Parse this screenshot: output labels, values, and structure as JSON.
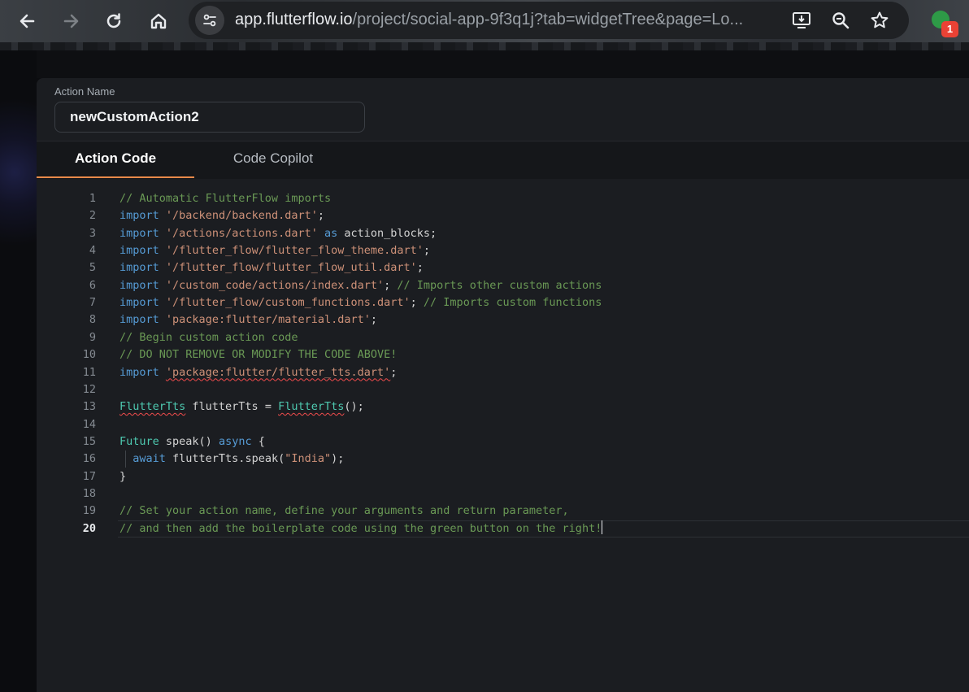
{
  "browser": {
    "url_host": "app.flutterflow.io",
    "url_path": "/project/social-app-9f3q1j?tab=widgetTree&page=Lo...",
    "extension_badge": "1",
    "icons": [
      "back-arrow-icon",
      "forward-arrow-icon",
      "reload-icon",
      "home-icon",
      "site-info-icon",
      "install-app-icon",
      "zoom-icon",
      "bookmark-star-icon",
      "extension-icon"
    ]
  },
  "panel": {
    "action_name_label": "Action Name",
    "action_name_value": "newCustomAction2",
    "tabs": [
      {
        "label": "Action Code",
        "active": true
      },
      {
        "label": "Code Copilot",
        "active": false
      }
    ]
  },
  "editor": {
    "current_line": 20,
    "lines": [
      {
        "n": "1",
        "tokens": [
          {
            "t": "// Automatic FlutterFlow imports",
            "c": "com"
          }
        ]
      },
      {
        "n": "2",
        "tokens": [
          {
            "t": "import",
            "c": "kw"
          },
          {
            "t": " ",
            "c": "plain"
          },
          {
            "t": "'/backend/backend.dart'",
            "c": "str"
          },
          {
            "t": ";",
            "c": "plain"
          }
        ]
      },
      {
        "n": "3",
        "tokens": [
          {
            "t": "import",
            "c": "kw"
          },
          {
            "t": " ",
            "c": "plain"
          },
          {
            "t": "'/actions/actions.dart'",
            "c": "str"
          },
          {
            "t": " ",
            "c": "plain"
          },
          {
            "t": "as",
            "c": "kw"
          },
          {
            "t": " action_blocks;",
            "c": "plain"
          }
        ]
      },
      {
        "n": "4",
        "tokens": [
          {
            "t": "import",
            "c": "kw"
          },
          {
            "t": " ",
            "c": "plain"
          },
          {
            "t": "'/flutter_flow/flutter_flow_theme.dart'",
            "c": "str"
          },
          {
            "t": ";",
            "c": "plain"
          }
        ]
      },
      {
        "n": "5",
        "tokens": [
          {
            "t": "import",
            "c": "kw"
          },
          {
            "t": " ",
            "c": "plain"
          },
          {
            "t": "'/flutter_flow/flutter_flow_util.dart'",
            "c": "str"
          },
          {
            "t": ";",
            "c": "plain"
          }
        ]
      },
      {
        "n": "6",
        "tokens": [
          {
            "t": "import",
            "c": "kw"
          },
          {
            "t": " ",
            "c": "plain"
          },
          {
            "t": "'/custom_code/actions/index.dart'",
            "c": "str"
          },
          {
            "t": "; ",
            "c": "plain"
          },
          {
            "t": "// Imports other custom actions",
            "c": "com"
          }
        ]
      },
      {
        "n": "7",
        "tokens": [
          {
            "t": "import",
            "c": "kw"
          },
          {
            "t": " ",
            "c": "plain"
          },
          {
            "t": "'/flutter_flow/custom_functions.dart'",
            "c": "str"
          },
          {
            "t": "; ",
            "c": "plain"
          },
          {
            "t": "// Imports custom functions",
            "c": "com"
          }
        ]
      },
      {
        "n": "8",
        "tokens": [
          {
            "t": "import",
            "c": "kw"
          },
          {
            "t": " ",
            "c": "plain"
          },
          {
            "t": "'package:flutter/material.dart'",
            "c": "str"
          },
          {
            "t": ";",
            "c": "plain"
          }
        ]
      },
      {
        "n": "9",
        "tokens": [
          {
            "t": "// Begin custom action code",
            "c": "com"
          }
        ]
      },
      {
        "n": "10",
        "tokens": [
          {
            "t": "// DO NOT REMOVE OR MODIFY THE CODE ABOVE!",
            "c": "com"
          }
        ]
      },
      {
        "n": "11",
        "tokens": [
          {
            "t": "import",
            "c": "kw"
          },
          {
            "t": " ",
            "c": "plain"
          },
          {
            "t": "'package:flutter/flutter_tts.dart'",
            "c": "str",
            "err": true
          },
          {
            "t": ";",
            "c": "plain"
          }
        ]
      },
      {
        "n": "12",
        "tokens": []
      },
      {
        "n": "13",
        "tokens": [
          {
            "t": "FlutterTts",
            "c": "typ",
            "err": true
          },
          {
            "t": " flutterTts = ",
            "c": "plain"
          },
          {
            "t": "FlutterTts",
            "c": "typ",
            "err": true
          },
          {
            "t": "();",
            "c": "plain"
          }
        ]
      },
      {
        "n": "14",
        "tokens": []
      },
      {
        "n": "15",
        "tokens": [
          {
            "t": "Future",
            "c": "typ"
          },
          {
            "t": " speak() ",
            "c": "plain"
          },
          {
            "t": "async",
            "c": "kw"
          },
          {
            "t": " {",
            "c": "plain"
          }
        ]
      },
      {
        "n": "16",
        "tokens": [
          {
            "t": "  ",
            "c": "plain"
          },
          {
            "t": "await",
            "c": "kw"
          },
          {
            "t": " flutterTts.speak(",
            "c": "plain"
          },
          {
            "t": "\"India\"",
            "c": "str"
          },
          {
            "t": ");",
            "c": "plain"
          }
        ],
        "guide": true
      },
      {
        "n": "17",
        "tokens": [
          {
            "t": "}",
            "c": "plain"
          }
        ]
      },
      {
        "n": "18",
        "tokens": []
      },
      {
        "n": "19",
        "tokens": [
          {
            "t": "// Set your action name, define your arguments and return parameter,",
            "c": "com"
          }
        ]
      },
      {
        "n": "20",
        "tokens": [
          {
            "t": "// and then add the boilerplate code using the green button on the right!",
            "c": "com"
          }
        ],
        "caret": true
      }
    ]
  }
}
